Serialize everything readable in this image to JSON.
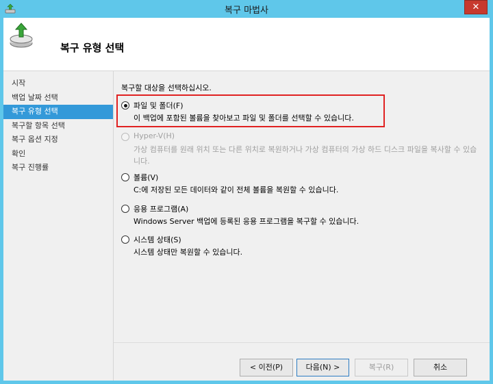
{
  "window": {
    "title": "복구 마법사",
    "close_label": "✕"
  },
  "header": {
    "title": "복구 유형 선택"
  },
  "nav": {
    "items": [
      {
        "label": "시작"
      },
      {
        "label": "백업 날짜 선택"
      },
      {
        "label": "복구 유형 선택"
      },
      {
        "label": "복구할 항목 선택"
      },
      {
        "label": "복구 옵션 지정"
      },
      {
        "label": "확인"
      },
      {
        "label": "복구 진행률"
      }
    ],
    "active_index": 2
  },
  "main": {
    "instruction": "복구할 대상을 선택하십시오.",
    "options": [
      {
        "label": "파일 및 폴더(F)",
        "description": "이 백업에 포함된 볼륨을 찾아보고 파일 및 폴더를 선택할 수 있습니다.",
        "selected": true,
        "enabled": true
      },
      {
        "label": "Hyper-V(H)",
        "description": "가상 컴퓨터를 원래 위치 또는 다른 위치로 복원하거나 가상 컴퓨터의 가상 하드 디스크 파일을 복사할 수 있습니다.",
        "selected": false,
        "enabled": false
      },
      {
        "label": "볼륨(V)",
        "description": "C:에 저장된 모든 데이터와 같이 전체 볼륨을 복원할 수 있습니다.",
        "selected": false,
        "enabled": true
      },
      {
        "label": "응용 프로그램(A)",
        "description": "Windows Server 백업에 등록된 응용 프로그램을 복구할 수 있습니다.",
        "selected": false,
        "enabled": true
      },
      {
        "label": "시스템 상태(S)",
        "description": "시스템 상태만 복원할 수 있습니다.",
        "selected": false,
        "enabled": true
      }
    ]
  },
  "buttons": {
    "prev": "< 이전(P)",
    "next": "다음(N) >",
    "recover": "복구(R)",
    "cancel": "취소"
  },
  "colors": {
    "titlebar": "#5fc7ea",
    "nav_active": "#3399d9",
    "close": "#c7392e",
    "highlight_border": "#e02020"
  }
}
